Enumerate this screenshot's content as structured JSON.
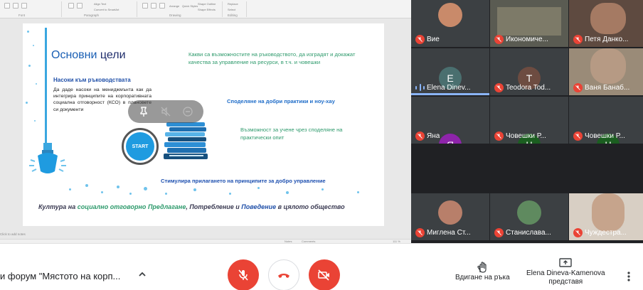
{
  "ribbon": {
    "items": [
      "Align Text",
      "Convert to SmartArt",
      "Arrange",
      "Quick Styles",
      "Shape Outline",
      "Shape Effects",
      "Replace",
      "Select"
    ],
    "groups": [
      "Font",
      "Paragraph",
      "Drawing",
      "Editing"
    ]
  },
  "slide": {
    "title_part1": "Основни",
    "title_part2": "цели",
    "guide_heading": "Насоки към ръководствата",
    "guide_text": "Да даде насоки на мениджмънта как да интегрира принципите на корпоративната социална отговорност (КСО) в плановете си документи",
    "goal1": "Какви са възможностите на ръководството, да изградят и докажат качества за управление на ресурси, в т.ч. и човешки",
    "goal2": "Споделяне на добри практики и ноу-хау",
    "goal3": "Възможност за учене чрез споделяне на практически опит",
    "goal4": "Стимулира прилагането на принципите за добро управление",
    "start_label": "START",
    "bottom_a": "Култура на ",
    "bottom_b": "социално отговорно",
    "bottom_c": " Предлагане",
    "bottom_d": ", Потребление и ",
    "bottom_e": "Поведение",
    "bottom_f": " в цялото общество"
  },
  "notes_placeholder": "Click to add notes",
  "statusbar": {
    "notes": "Notes",
    "comments": "Comments",
    "zoom": "111 %"
  },
  "participants": [
    {
      "name": "Вие",
      "mic": "off",
      "kind": "video",
      "color": "#c98a6a"
    },
    {
      "name": "Икономиче...",
      "mic": "off",
      "kind": "video",
      "color": "#6b6a5e"
    },
    {
      "name": "Петя Данко...",
      "mic": "off",
      "kind": "video",
      "color": "#7a5a4a"
    },
    {
      "name": "Elena Dinev...",
      "mic": "speaking",
      "kind": "avatar",
      "initial": "E",
      "color": "#4a6f6f"
    },
    {
      "name": "Teodora Tod...",
      "mic": "off",
      "kind": "avatar",
      "initial": "T",
      "color": "#6d4c41"
    },
    {
      "name": "Ваня Банаб...",
      "mic": "off",
      "kind": "video",
      "color": "#8c7d6a"
    },
    {
      "name": "Яна",
      "mic": "off",
      "kind": "avatar",
      "initial": "Я",
      "color": "#8e24aa"
    },
    {
      "name": "Човешки Р...",
      "mic": "off",
      "kind": "avatar",
      "initial": "Ч",
      "color": "#1b5e20"
    },
    {
      "name": "Човешки Р...",
      "mic": "off",
      "kind": "avatar",
      "initial": "Ч",
      "color": "#1b5e20"
    },
    {
      "name": "Миглена Ст...",
      "mic": "off",
      "kind": "video",
      "color": "#b87f6a"
    },
    {
      "name": "Станислава...",
      "mic": "off",
      "kind": "video",
      "color": "#5f8a5f"
    },
    {
      "name": "Чуждестра...",
      "mic": "off",
      "kind": "video",
      "color": "#c4b7a8"
    }
  ],
  "bottom_bar": {
    "meeting_title": "и форум \"Мястото на корп...",
    "raise_hand_label": "Вдигане на ръка",
    "presenter_name": "Elena Dineva-Kamenova",
    "presenter_action": "представя"
  },
  "colors": {
    "danger": "#ea4335",
    "accent": "#8ab4f8",
    "grid_bg": "#202124"
  }
}
